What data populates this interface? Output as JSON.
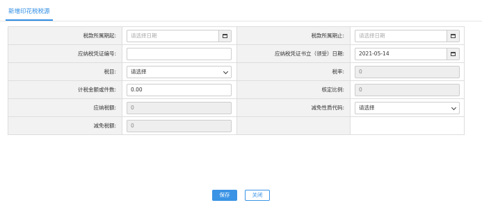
{
  "tab": {
    "label": "新增印花税税源"
  },
  "form": {
    "row1": {
      "left_label": "税款所属期起:",
      "left_placeholder": "请选择日期",
      "right_label": "税款所属期止:",
      "right_placeholder": "请选择日期"
    },
    "row2": {
      "left_label": "应纳税凭证编号:",
      "left_value": "",
      "right_label": "应纳税凭证书立（领受）日期:",
      "right_value": "2021-05-14"
    },
    "row3": {
      "left_label": "税目:",
      "left_select": "请选择",
      "right_label": "税率:",
      "right_value": "0"
    },
    "row4": {
      "left_label": "计税金额或件数:",
      "left_value": "0.00",
      "right_label": "核定比例:",
      "right_value": "0"
    },
    "row5": {
      "left_label": "应纳税额:",
      "left_value": "0",
      "right_label": "减免性质代码:",
      "right_select": "请选择"
    },
    "row6": {
      "left_label": "减免税额:",
      "left_value": "0"
    }
  },
  "buttons": {
    "save": "保存",
    "close": "关闭"
  },
  "colors": {
    "accent": "#2f8de4",
    "label_bg": "#f2f2f2",
    "disabled_bg": "#eeeeee"
  }
}
